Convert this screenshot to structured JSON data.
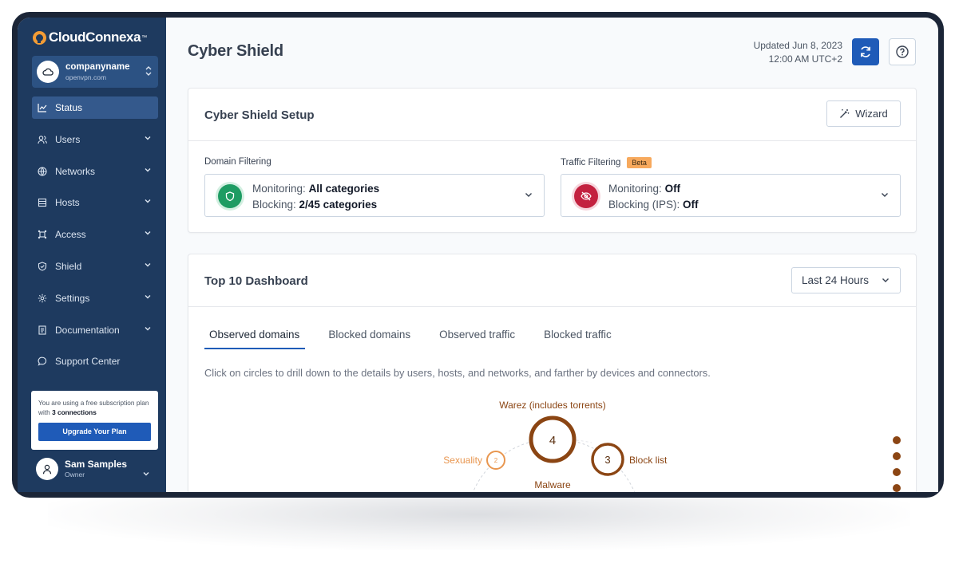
{
  "app": {
    "brand": "CloudConnexa",
    "trademark": "™"
  },
  "company": {
    "name": "companyname",
    "domain": "openvpn.com"
  },
  "nav": [
    {
      "label": "Status",
      "icon": "chart-line-icon",
      "active": true
    },
    {
      "label": "Users",
      "icon": "users-icon"
    },
    {
      "label": "Networks",
      "icon": "globe-icon"
    },
    {
      "label": "Hosts",
      "icon": "server-icon"
    },
    {
      "label": "Access",
      "icon": "access-icon"
    },
    {
      "label": "Shield",
      "icon": "shield-icon"
    },
    {
      "label": "Settings",
      "icon": "gear-icon"
    },
    {
      "label": "Documentation",
      "icon": "document-icon"
    },
    {
      "label": "Support Center",
      "icon": "chat-icon"
    }
  ],
  "promo": {
    "text_before": "You are using a free subscription plan with ",
    "bold": "3 connections",
    "button": "Upgrade Your Plan"
  },
  "user": {
    "name": "Sam Samples",
    "role": "Owner"
  },
  "header": {
    "title": "Cyber Shield",
    "updated_line1": "Updated Jun 8, 2023",
    "updated_line2": "12:00 AM UTC+2"
  },
  "setup": {
    "title": "Cyber Shield Setup",
    "wizard": "Wizard",
    "domain": {
      "label": "Domain Filtering",
      "monitoring_label": "Monitoring:",
      "monitoring_value": "All categories",
      "blocking_label": "Blocking:",
      "blocking_value": "2/45 categories"
    },
    "traffic": {
      "label": "Traffic Filtering",
      "badge": "Beta",
      "monitoring_label": "Monitoring:",
      "monitoring_value": "Off",
      "blocking_label": "Blocking (IPS):",
      "blocking_value": "Off"
    }
  },
  "dashboard": {
    "title": "Top 10 Dashboard",
    "range": "Last 24 Hours",
    "tabs": [
      "Observed domains",
      "Blocked domains",
      "Observed traffic",
      "Blocked traffic"
    ],
    "hint": "Click on circles to drill down to the details by users, hosts, and networks, and farther by devices and connectors.",
    "bubbles": [
      {
        "label": "Warez (includes torrents)",
        "count": "4"
      },
      {
        "label": "Block list",
        "count": "3"
      },
      {
        "label": "Sexuality",
        "count": "2"
      },
      {
        "label": "Malware",
        "count": ""
      }
    ]
  },
  "colors": {
    "sidebar": "#1e3a5f",
    "accent": "#1f5bb8",
    "bubble_dark": "#8b4513",
    "bubble_light": "#e8964f"
  }
}
